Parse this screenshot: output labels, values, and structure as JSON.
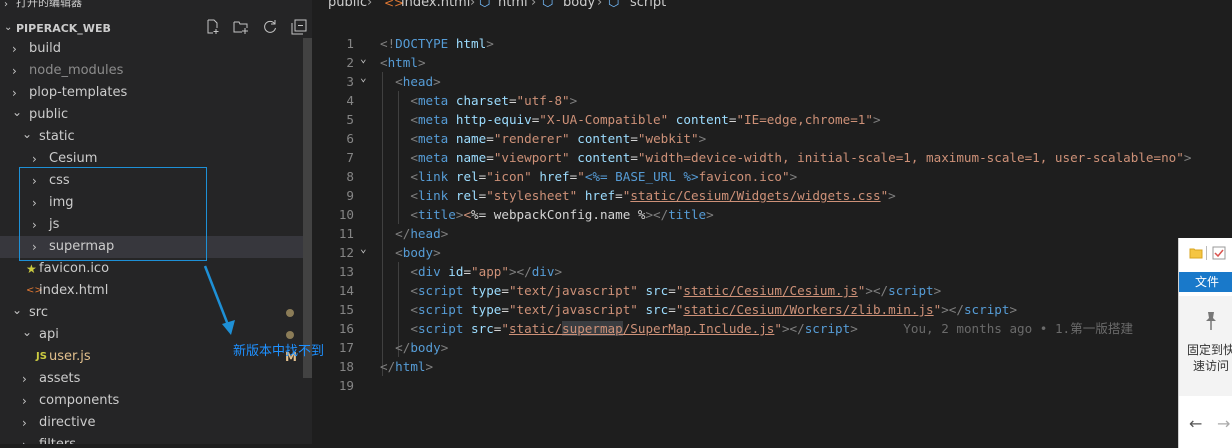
{
  "open_editors": {
    "label": "打开的编辑器"
  },
  "explorer": {
    "title": "PIPERACK_WEB",
    "actions": [
      "new-file-icon",
      "new-folder-icon",
      "refresh-icon",
      "collapse-all-icon"
    ],
    "items": [
      {
        "name": "build",
        "kind": "folder"
      },
      {
        "name": "node_modules",
        "kind": "folder"
      },
      {
        "name": "plop-templates",
        "kind": "folder"
      },
      {
        "name": "public",
        "kind": "folder-open"
      },
      {
        "name": "static",
        "kind": "folder-open"
      },
      {
        "name": "Cesium",
        "kind": "folder"
      },
      {
        "name": "css",
        "kind": "folder"
      },
      {
        "name": "img",
        "kind": "folder"
      },
      {
        "name": "js",
        "kind": "folder"
      },
      {
        "name": "supermap",
        "kind": "folder"
      },
      {
        "name": "favicon.ico",
        "kind": "file"
      },
      {
        "name": "index.html",
        "kind": "file"
      },
      {
        "name": "src",
        "kind": "folder-open"
      },
      {
        "name": "api",
        "kind": "folder-open"
      },
      {
        "name": "user.js",
        "kind": "file",
        "file_icon": "JS",
        "badge": "M"
      },
      {
        "name": "assets",
        "kind": "folder"
      },
      {
        "name": "components",
        "kind": "folder"
      },
      {
        "name": "directive",
        "kind": "folder"
      },
      {
        "name": "filters",
        "kind": "folder"
      }
    ]
  },
  "annotation": {
    "text": "新版本中找不到"
  },
  "breadcrumb": {
    "items": [
      {
        "label": "public",
        "icon": ""
      },
      {
        "label": "index.html",
        "icon": "html-file-icon"
      },
      {
        "label": "html",
        "icon": "symbol-icon"
      },
      {
        "label": "body",
        "icon": "symbol-icon"
      },
      {
        "label": "script",
        "icon": "symbol-icon"
      }
    ]
  },
  "code": {
    "blame": "You, 2 months ago • 1.第一版搭建",
    "lines": [
      {
        "n": "1",
        "fold": "",
        "tokens": [
          [
            "p",
            "<!"
          ],
          [
            "tag",
            "DOCTYPE"
          ],
          [
            "text",
            " "
          ],
          [
            "attr",
            "html"
          ],
          [
            "p",
            ">"
          ]
        ]
      },
      {
        "n": "2",
        "fold": "v",
        "tokens": [
          [
            "p",
            "<"
          ],
          [
            "tag",
            "html"
          ],
          [
            "p",
            ">"
          ]
        ]
      },
      {
        "n": "3",
        "fold": "v",
        "tokens": [
          [
            "text",
            "  "
          ],
          [
            "p",
            "<"
          ],
          [
            "tag",
            "head"
          ],
          [
            "p",
            ">"
          ]
        ]
      },
      {
        "n": "4",
        "fold": "",
        "tokens": [
          [
            "text",
            "    "
          ],
          [
            "p",
            "<"
          ],
          [
            "tag",
            "meta"
          ],
          [
            "text",
            " "
          ],
          [
            "attr",
            "charset"
          ],
          [
            "text",
            "="
          ],
          [
            "str",
            "\"utf-8\""
          ],
          [
            "p",
            ">"
          ]
        ]
      },
      {
        "n": "5",
        "fold": "",
        "tokens": [
          [
            "text",
            "    "
          ],
          [
            "p",
            "<"
          ],
          [
            "tag",
            "meta"
          ],
          [
            "text",
            " "
          ],
          [
            "attr",
            "http-equiv"
          ],
          [
            "text",
            "="
          ],
          [
            "str",
            "\"X-UA-Compatible\""
          ],
          [
            "text",
            " "
          ],
          [
            "attr",
            "content"
          ],
          [
            "text",
            "="
          ],
          [
            "str",
            "\"IE=edge,chrome=1\""
          ],
          [
            "p",
            ">"
          ]
        ]
      },
      {
        "n": "6",
        "fold": "",
        "tokens": [
          [
            "text",
            "    "
          ],
          [
            "p",
            "<"
          ],
          [
            "tag",
            "meta"
          ],
          [
            "text",
            " "
          ],
          [
            "attr",
            "name"
          ],
          [
            "text",
            "="
          ],
          [
            "str",
            "\"renderer\""
          ],
          [
            "text",
            " "
          ],
          [
            "attr",
            "content"
          ],
          [
            "text",
            "="
          ],
          [
            "str",
            "\"webkit\""
          ],
          [
            "p",
            ">"
          ]
        ]
      },
      {
        "n": "7",
        "fold": "",
        "tokens": [
          [
            "text",
            "    "
          ],
          [
            "p",
            "<"
          ],
          [
            "tag",
            "meta"
          ],
          [
            "text",
            " "
          ],
          [
            "attr",
            "name"
          ],
          [
            "text",
            "="
          ],
          [
            "str",
            "\"viewport\""
          ],
          [
            "text",
            " "
          ],
          [
            "attr",
            "content"
          ],
          [
            "text",
            "="
          ],
          [
            "str",
            "\"width=device-width, initial-scale=1, maximum-scale=1, user-scalable=no\""
          ],
          [
            "p",
            ">"
          ]
        ]
      },
      {
        "n": "8",
        "fold": "",
        "tokens": [
          [
            "text",
            "    "
          ],
          [
            "p",
            "<"
          ],
          [
            "tag",
            "link"
          ],
          [
            "text",
            " "
          ],
          [
            "attr",
            "rel"
          ],
          [
            "text",
            "="
          ],
          [
            "str",
            "\"icon\""
          ],
          [
            "text",
            " "
          ],
          [
            "attr",
            "href"
          ],
          [
            "text",
            "="
          ],
          [
            "str",
            "\""
          ],
          [
            "tag",
            "<%= BASE_URL %>"
          ],
          [
            "str",
            "favicon.ico\""
          ],
          [
            "p",
            ">"
          ]
        ]
      },
      {
        "n": "9",
        "fold": "",
        "tokens": [
          [
            "text",
            "    "
          ],
          [
            "p",
            "<"
          ],
          [
            "tag",
            "link"
          ],
          [
            "text",
            " "
          ],
          [
            "attr",
            "rel"
          ],
          [
            "text",
            "="
          ],
          [
            "str",
            "\"stylesheet\""
          ],
          [
            "text",
            " "
          ],
          [
            "attr",
            "href"
          ],
          [
            "text",
            "="
          ],
          [
            "str",
            "\""
          ],
          [
            "strul",
            "static/Cesium/Widgets/widgets.css"
          ],
          [
            "str",
            "\""
          ],
          [
            "p",
            ">"
          ]
        ]
      },
      {
        "n": "10",
        "fold": "",
        "tokens": [
          [
            "text",
            "    "
          ],
          [
            "p",
            "<"
          ],
          [
            "tag",
            "title"
          ],
          [
            "p",
            ">"
          ],
          [
            "str",
            "<"
          ],
          [
            "text",
            "%= webpackConfig.name %"
          ],
          [
            "p",
            ">"
          ],
          [
            "p",
            "</"
          ],
          [
            "tag",
            "title"
          ],
          [
            "p",
            ">"
          ]
        ]
      },
      {
        "n": "11",
        "fold": "",
        "tokens": [
          [
            "text",
            "  "
          ],
          [
            "p",
            "</"
          ],
          [
            "tag",
            "head"
          ],
          [
            "p",
            ">"
          ]
        ]
      },
      {
        "n": "12",
        "fold": "v",
        "tokens": [
          [
            "text",
            "  "
          ],
          [
            "p",
            "<"
          ],
          [
            "tag",
            "body"
          ],
          [
            "p",
            ">"
          ]
        ]
      },
      {
        "n": "13",
        "fold": "",
        "tokens": [
          [
            "text",
            "    "
          ],
          [
            "p",
            "<"
          ],
          [
            "tag",
            "div"
          ],
          [
            "text",
            " "
          ],
          [
            "attr",
            "id"
          ],
          [
            "text",
            "="
          ],
          [
            "str",
            "\"app\""
          ],
          [
            "p",
            "></"
          ],
          [
            "tag",
            "div"
          ],
          [
            "p",
            ">"
          ]
        ]
      },
      {
        "n": "14",
        "fold": "",
        "tokens": [
          [
            "text",
            "    "
          ],
          [
            "p",
            "<"
          ],
          [
            "tag",
            "script"
          ],
          [
            "text",
            " "
          ],
          [
            "attr",
            "type"
          ],
          [
            "text",
            "="
          ],
          [
            "str",
            "\"text/javascript\""
          ],
          [
            "text",
            " "
          ],
          [
            "attr",
            "src"
          ],
          [
            "text",
            "="
          ],
          [
            "str",
            "\""
          ],
          [
            "strul",
            "static/Cesium/Cesium.js"
          ],
          [
            "str",
            "\""
          ],
          [
            "p",
            "></"
          ],
          [
            "tag",
            "script"
          ],
          [
            "p",
            ">"
          ]
        ]
      },
      {
        "n": "15",
        "fold": "",
        "tokens": [
          [
            "text",
            "    "
          ],
          [
            "p",
            "<"
          ],
          [
            "tag",
            "script"
          ],
          [
            "text",
            " "
          ],
          [
            "attr",
            "type"
          ],
          [
            "text",
            "="
          ],
          [
            "str",
            "\"text/javascript\""
          ],
          [
            "text",
            " "
          ],
          [
            "attr",
            "src"
          ],
          [
            "text",
            "="
          ],
          [
            "str",
            "\""
          ],
          [
            "strul",
            "static/Cesium/Workers/zlib.min.js"
          ],
          [
            "str",
            "\""
          ],
          [
            "p",
            "></"
          ],
          [
            "tag",
            "script"
          ],
          [
            "p",
            ">"
          ]
        ]
      },
      {
        "n": "16",
        "fold": "",
        "tokens": [
          [
            "text",
            "    "
          ],
          [
            "p",
            "<"
          ],
          [
            "tag",
            "script"
          ],
          [
            "text",
            " "
          ],
          [
            "attr",
            "src"
          ],
          [
            "text",
            "="
          ],
          [
            "str",
            "\""
          ],
          [
            "strul",
            "static/"
          ],
          [
            "strulsel",
            "supermap"
          ],
          [
            "strul",
            "/SuperMap.Include.js"
          ],
          [
            "str",
            "\""
          ],
          [
            "p",
            "></"
          ],
          [
            "tag",
            "script"
          ],
          [
            "p",
            ">"
          ],
          [
            "blame",
            ""
          ]
        ]
      },
      {
        "n": "17",
        "fold": "",
        "tokens": [
          [
            "text",
            "  "
          ],
          [
            "p",
            "</"
          ],
          [
            "tag",
            "body"
          ],
          [
            "p",
            ">"
          ]
        ]
      },
      {
        "n": "18",
        "fold": "",
        "tokens": [
          [
            "p",
            "</"
          ],
          [
            "tag",
            "html"
          ],
          [
            "p",
            ">"
          ]
        ]
      },
      {
        "n": "19",
        "fold": "",
        "tokens": []
      }
    ]
  },
  "side_panel": {
    "menu_file": "文件",
    "pin_label_line1": "固定到快",
    "pin_label_line2": "速访问"
  },
  "colors": {
    "folder_icon": "#dcb67a",
    "html_icon": "#e37933",
    "js_icon": "#cbcb41",
    "accent": "#1979ca"
  }
}
